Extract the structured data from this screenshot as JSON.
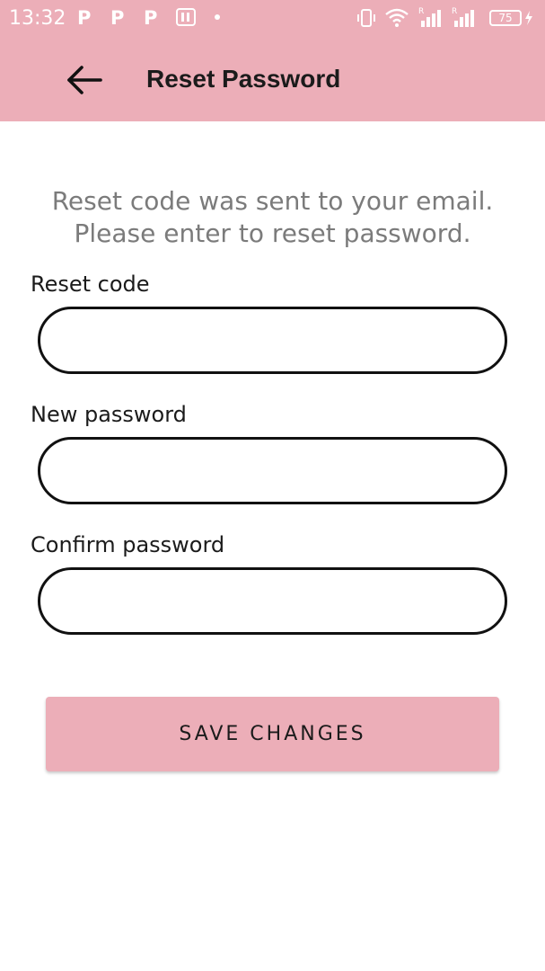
{
  "status_bar": {
    "time": "13:32",
    "notification_icons": [
      "P",
      "P",
      "P"
    ],
    "battery_level": "75",
    "background": "#ecaeb8"
  },
  "app_bar": {
    "title": "Reset Password",
    "back_icon": "arrow-left-icon",
    "background": "#ecaeb8"
  },
  "message": {
    "line1": "Reset code was sent to your email.",
    "line2": "Please enter to reset password."
  },
  "form": {
    "reset_code": {
      "label": "Reset code",
      "value": ""
    },
    "new_password": {
      "label": "New password",
      "value": ""
    },
    "confirm_password": {
      "label": "Confirm password",
      "value": ""
    }
  },
  "save_button": {
    "label": "SAVE CHANGES"
  }
}
